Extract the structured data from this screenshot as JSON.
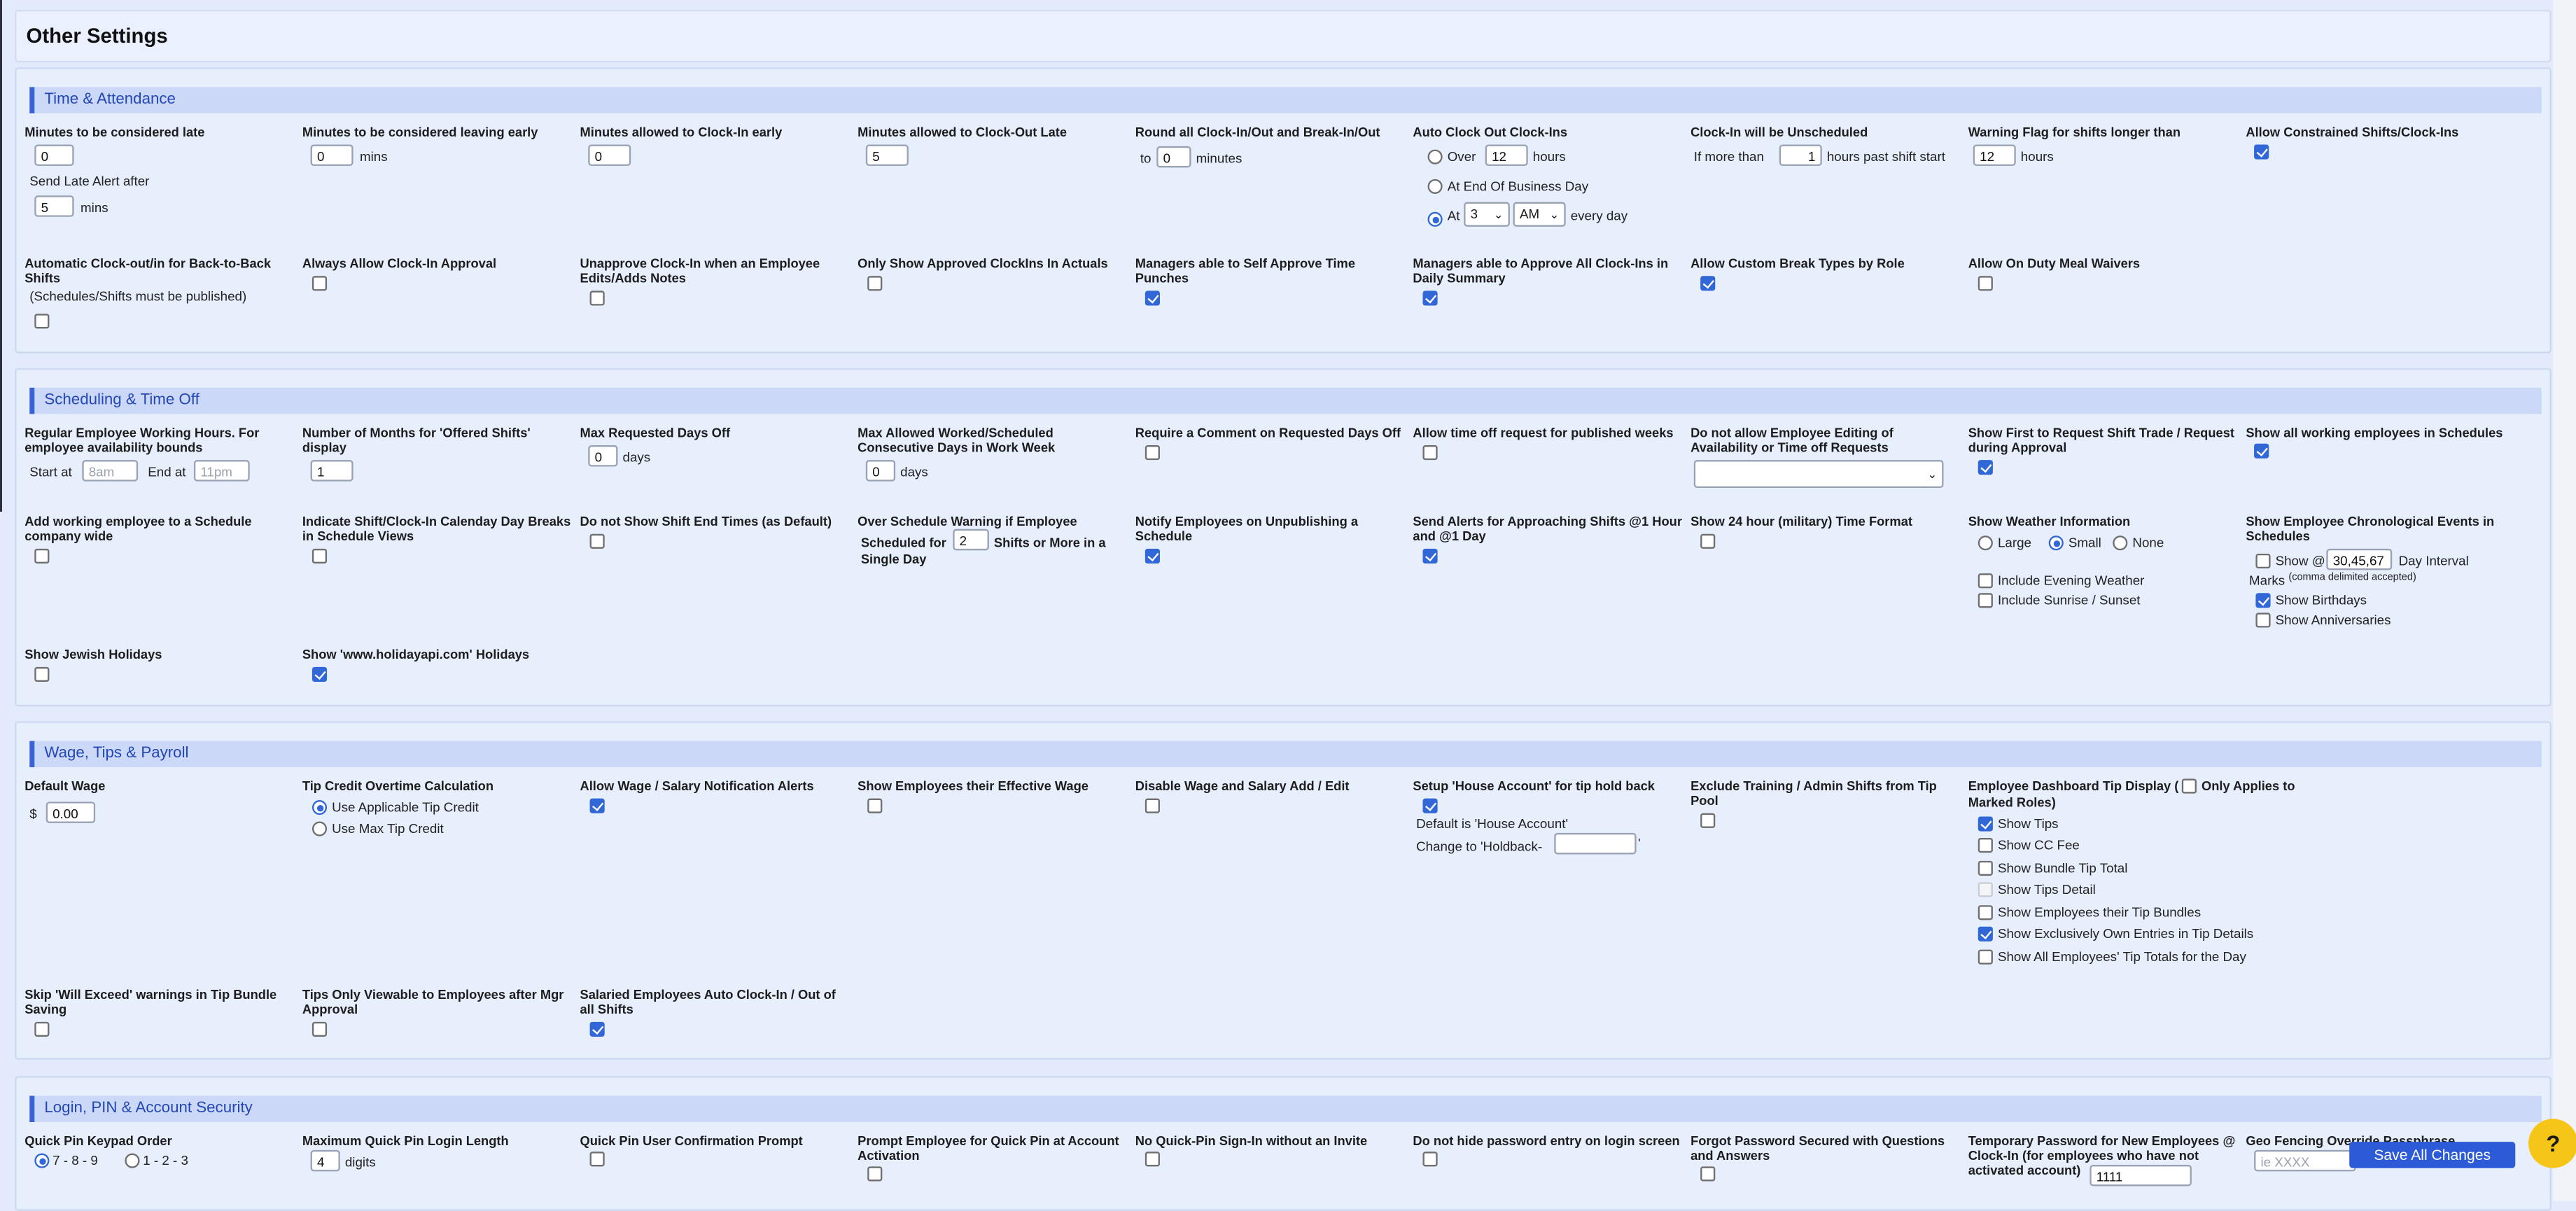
{
  "page_title": "Other Settings",
  "sections": {
    "time": "Time & Attendance",
    "sched": "Scheduling & Time Off",
    "wage": "Wage, Tips & Payroll",
    "login": "Login, PIN & Account Security"
  },
  "time": {
    "late_label": "Minutes to be considered late",
    "late_value": "0",
    "late_alert_label": "Send Late Alert after",
    "late_alert_value": "5",
    "mins": "mins",
    "early_leave_label": "Minutes to be considered leaving early",
    "early_leave_value": "0",
    "clockin_early_label": "Minutes allowed to Clock-In early",
    "clockin_early_value": "0",
    "clockout_late_label": "Minutes allowed to Clock-Out Late",
    "clockout_late_value": "5",
    "round_label": "Round all Clock-In/Out and Break-In/Out",
    "round_to": "to",
    "round_value": "0",
    "minutes": "minutes",
    "auto_label": "Auto Clock Out Clock-Ins",
    "auto_over": "Over",
    "auto_over_value": "12",
    "hours": "hours",
    "auto_eod": "At End Of Business Day",
    "auto_at": "At",
    "auto_at_hour": "3",
    "auto_at_ampm": "AM",
    "every_day": "every day",
    "unsched_label": "Clock-In will be Unscheduled",
    "unsched_prefix": "If more than",
    "unsched_value": "1",
    "unsched_suffix": "hours past shift start",
    "warn_label": "Warning Flag for shifts longer than",
    "warn_value": "12",
    "constrained_label": "Allow Constrained Shifts/Clock-Ins",
    "b2b_label": "Automatic Clock-out/in for Back-to-Back Shifts",
    "b2b_note": "(Schedules/Shifts must be published)",
    "always_approval_label": "Always Allow Clock-In Approval",
    "unapprove_label": "Unapprove Clock-In when an Employee Edits/Adds Notes",
    "only_approved_label": "Only Show Approved ClockIns In Actuals",
    "mgr_self_label": "Managers able to Self Approve Time Punches",
    "mgr_all_label": "Managers able to Approve All Clock-Ins in Daily Summary",
    "custom_break_label": "Allow Custom Break Types by Role",
    "meal_waiver_label": "Allow On Duty Meal Waivers"
  },
  "sched": {
    "working_hours_label": "Regular Employee Working Hours. For employee availability bounds",
    "start_at": "Start at",
    "start_ph": "8am",
    "end_at": "End at",
    "end_ph": "11pm",
    "months_label": "Number of Months for 'Offered Shifts' display",
    "months_value": "1",
    "max_req_label": "Max Requested Days Off",
    "max_req_value": "0",
    "days": "days",
    "max_consec_label": "Max Allowed Worked/Scheduled Consecutive Days in Work Week",
    "max_consec_value": "0",
    "require_comment_label": "Require a Comment on Requested Days Off",
    "allow_published_label": "Allow time off request for published weeks",
    "no_edit_label": "Do not allow Employee Editing of Availability or Time off Requests",
    "first_request_label": "Show First to Request Shift Trade / Request during Approval",
    "all_working_label": "Show all working employees in Schedules",
    "add_working_label": "Add working employee to a Schedule company wide",
    "indicate_breaks_label": "Indicate Shift/Clock-In Calenday Day Breaks in Schedule Views",
    "no_end_label": "Do not Show Shift End Times (as Default)",
    "over_warn_label": "Over Schedule Warning if Employee",
    "over_warn_prefix": "Scheduled for",
    "over_warn_value": "2",
    "over_warn_suffix": "Shifts or More in a",
    "over_warn_suffix2": "Single Day",
    "notify_unpublish_label": "Notify Employees on Unpublishing a Schedule",
    "approach_label": "Send Alerts for Approaching Shifts @1 Hour and @1 Day",
    "military_label": "Show 24 hour (military) Time Format",
    "weather_label": "Show Weather Information",
    "weather_large": "Large",
    "weather_small": "Small",
    "weather_none": "None",
    "evening_weather": "Include Evening Weather",
    "sunrise": "Include Sunrise / Sunset",
    "chrono_label": "Show Employee Chronological Events in Schedules",
    "chrono_show": "Show @",
    "chrono_value": "30,45,67",
    "chrono_interval": "Day Interval",
    "chrono_marks": "Marks",
    "chrono_note": "(comma delimited accepted)",
    "birthdays": "Show Birthdays",
    "anniversaries": "Show Anniversaries",
    "jewish_label": "Show Jewish Holidays",
    "holidayapi_label": "Show 'www.holidayapi.com' Holidays"
  },
  "wage": {
    "default_wage_label": "Default Wage",
    "currency": "$",
    "default_wage_value": "0.00",
    "tip_credit_label": "Tip Credit Overtime Calculation",
    "tip_applicable": "Use Applicable Tip Credit",
    "tip_max": "Use Max Tip Credit",
    "notify_label": "Allow Wage / Salary Notification Alerts",
    "effective_label": "Show Employees their Effective Wage",
    "disable_label": "Disable Wage and Salary Add / Edit",
    "house_label": "Setup 'House Account' for tip hold back",
    "house_default": "Default is 'House Account'",
    "house_change": "Change to 'Holdback-",
    "house_quote": "'",
    "exclude_label": "Exclude Training / Admin Shifts from Tip Pool",
    "dash_label_a": "Employee Dashboard Tip Display (",
    "dash_label_b": "Only Applies to",
    "dash_label_c": "Marked Roles)",
    "show_tips": "Show Tips",
    "show_cc": "Show CC Fee",
    "show_bundle": "Show Bundle Tip Total",
    "show_detail": "Show Tips Detail",
    "show_emp_bundles": "Show Employees their Tip Bundles",
    "show_own": "Show Exclusively Own Entries in Tip Details",
    "show_all_totals": "Show All Employees' Tip Totals for the Day",
    "skip_label": "Skip 'Will Exceed' warnings in Tip Bundle Saving",
    "tips_after_label": "Tips Only Viewable to Employees after Mgr Approval",
    "salaried_label": "Salaried Employees Auto Clock-In / Out of all Shifts"
  },
  "login": {
    "keypad_label": "Quick Pin Keypad Order",
    "keypad_789": "7 - 8 - 9",
    "keypad_123": "1 - 2 - 3",
    "max_len_label": "Maximum Quick Pin Login Length",
    "max_len_value": "4",
    "digits": "digits",
    "confirm_label": "Quick Pin User Confirmation Prompt",
    "prompt_label": "Prompt Employee for Quick Pin at Account Activation",
    "no_quick_label": "No Quick-Pin Sign-In without an Invite",
    "no_hide_label": "Do not hide password entry on login screen",
    "forgot_label": "Forgot Password Secured with Questions and Answers",
    "temp_label": "Temporary Password for New Employees @ Clock-In (for employees who have not activated account)",
    "temp_value": "1111",
    "geo_label": "Geo Fencing Override Passphrase",
    "geo_ph": "ie XXXX"
  },
  "save_button": "Save All Changes",
  "help_button": "?"
}
